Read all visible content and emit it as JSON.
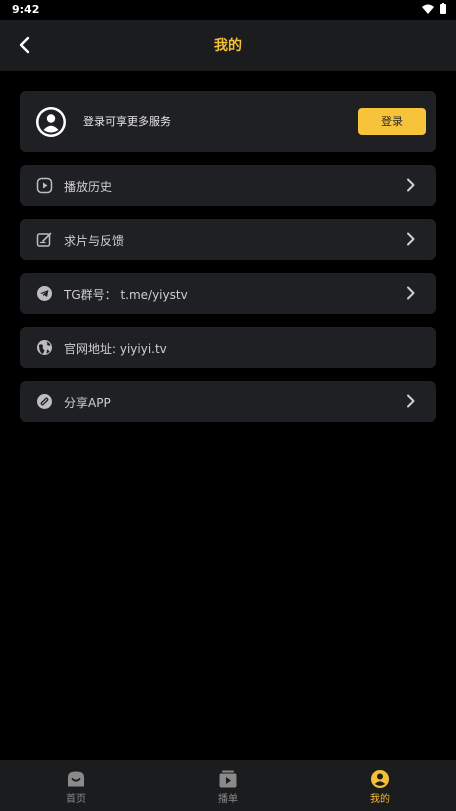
{
  "status_bar": {
    "time": "9:42"
  },
  "header": {
    "title": "我的"
  },
  "login": {
    "prompt": "登录可享更多服务",
    "button_label": "登录"
  },
  "menu": {
    "items": [
      {
        "label": "播放历史",
        "icon": "play-history-icon",
        "has_chevron": true
      },
      {
        "label": "求片与反馈",
        "icon": "edit-feedback-icon",
        "has_chevron": true
      },
      {
        "label": "TG群号：  t.me/yiystv",
        "icon": "telegram-icon",
        "has_chevron": true
      },
      {
        "label": "官网地址: yiyiyi.tv",
        "icon": "globe-icon",
        "has_chevron": false
      },
      {
        "label": "分享APP",
        "icon": "share-link-icon",
        "has_chevron": true
      }
    ]
  },
  "tabs": [
    {
      "label": "首页",
      "icon": "home-icon",
      "active": false
    },
    {
      "label": "播单",
      "icon": "playlist-icon",
      "active": false
    },
    {
      "label": "我的",
      "icon": "profile-icon",
      "active": true
    }
  ],
  "colors": {
    "accent": "#f4be37",
    "button": "#f7c33a",
    "card": "#1f2023",
    "bar": "#1b1c1e",
    "background": "#000000"
  }
}
